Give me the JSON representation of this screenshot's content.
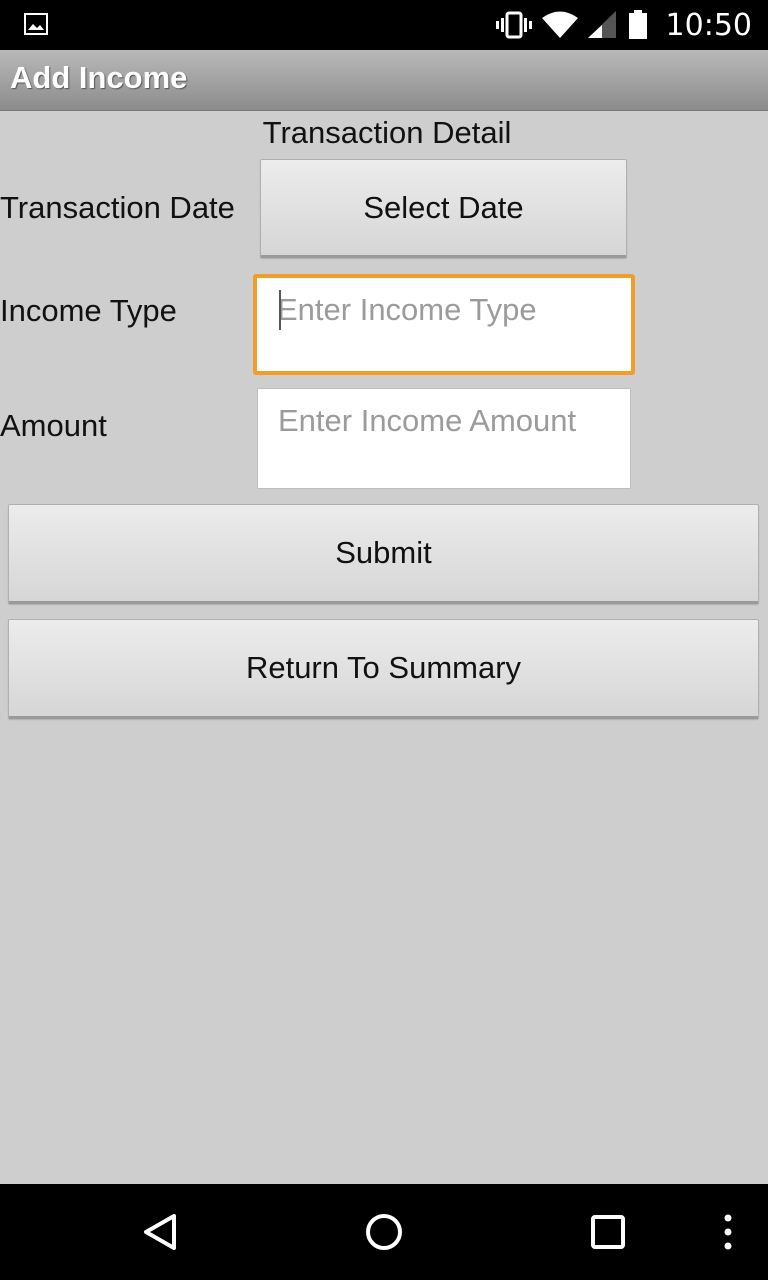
{
  "status_bar": {
    "time": "10:50",
    "icons": [
      "gallery-notification-icon",
      "vibrate-icon",
      "wifi-icon",
      "signal-icon",
      "battery-icon"
    ]
  },
  "action_bar": {
    "title": "Add Income"
  },
  "form": {
    "section_title": "Transaction Detail",
    "date_label": "Transaction Date",
    "date_button": "Select Date",
    "income_type_label": "Income Type",
    "income_type_placeholder": "Enter Income Type",
    "income_type_value": "",
    "amount_label": "Amount",
    "amount_placeholder": "Enter Income Amount",
    "amount_value": ""
  },
  "actions": {
    "submit": "Submit",
    "return": "Return To Summary"
  },
  "nav_bar": {
    "icons": [
      "back-icon",
      "home-icon",
      "recents-icon",
      "overflow-menu-icon"
    ]
  },
  "colors": {
    "focus_accent": "#f39c2a",
    "background": "#cecece"
  }
}
